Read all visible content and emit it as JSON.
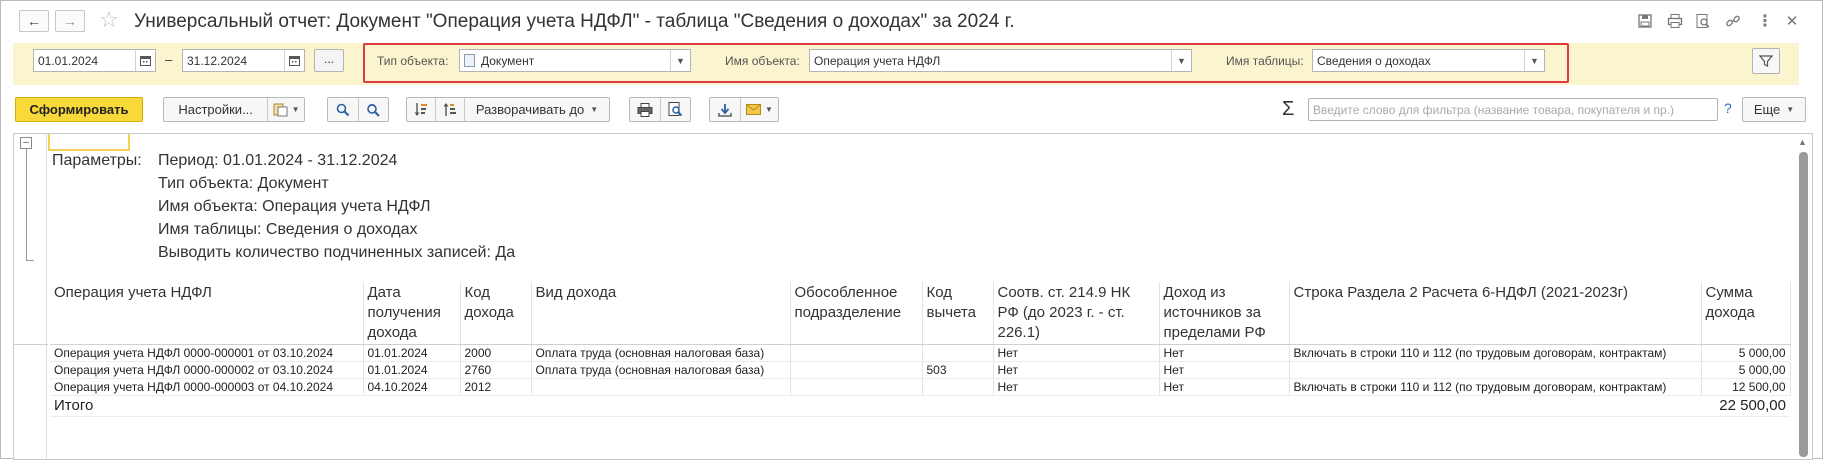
{
  "window": {
    "title": "Универсальный отчет: Документ \"Операция учета НДФЛ\" - таблица \"Сведения о доходах\" за 2024 г.",
    "icons": [
      "back-arrow-icon",
      "forward-arrow-icon",
      "star-icon",
      "save-icon",
      "print-icon",
      "preview-icon",
      "link-icon",
      "more-vertical-icon",
      "close-icon"
    ]
  },
  "filter": {
    "date_from": "01.01.2024",
    "date_to": "31.12.2024",
    "dash": "–",
    "period_button": "...",
    "object_type_label": "Тип объекта:",
    "object_type_value": "Документ",
    "object_name_label": "Имя объекта:",
    "object_name_value": "Операция учета НДФЛ",
    "table_name_label": "Имя таблицы:",
    "table_name_value": "Сведения о доходах"
  },
  "toolbar": {
    "generate": "Сформировать",
    "settings": "Настройки...",
    "expand_to": "Разворачивать до",
    "search_placeholder": "Введите слово для фильтра (название товара, покупателя и пр.)",
    "help": "?",
    "more": "Еще"
  },
  "report": {
    "params_label": "Параметры:",
    "params": [
      "Период: 01.01.2024 - 31.12.2024",
      "Тип объекта: Документ",
      "Имя объекта: Операция учета НДФЛ",
      "Имя таблицы: Сведения о доходах",
      "Выводить количество подчиненных записей: Да"
    ],
    "columns": [
      "Операция учета НДФЛ",
      "Дата получения дохода",
      "Код дохода",
      "Вид дохода",
      "Обособленное подразделение",
      "Код вычета",
      "Соотв. ст. 214.9 НК РФ (до 2023 г. - ст. 226.1)",
      "Доход из источников за пределами РФ",
      "Строка Раздела 2 Расчета 6-НДФЛ (2021-2023г)",
      "Сумма дохода"
    ],
    "rows": [
      [
        "Операция учета НДФЛ 0000-000001 от 03.10.2024",
        "01.01.2024",
        "2000",
        "Оплата труда (основная налоговая база)",
        "",
        "",
        "Нет",
        "Нет",
        "Включать в строки 110 и 112 (по трудовым договорам, контрактам)",
        "5 000,00"
      ],
      [
        "Операция учета НДФЛ 0000-000002 от 03.10.2024",
        "01.01.2024",
        "2760",
        "Оплата труда (основная налоговая база)",
        "",
        "503",
        "Нет",
        "Нет",
        "",
        "5 000,00"
      ],
      [
        "Операция учета НДФЛ 0000-000003 от 04.10.2024",
        "04.10.2024",
        "2012",
        "",
        "",
        "",
        "Нет",
        "Нет",
        "Включать в строки 110 и 112 (по трудовым договорам, контрактам)",
        "12 500,00"
      ]
    ],
    "total_label": "Итого",
    "total_value": "22 500,00"
  }
}
